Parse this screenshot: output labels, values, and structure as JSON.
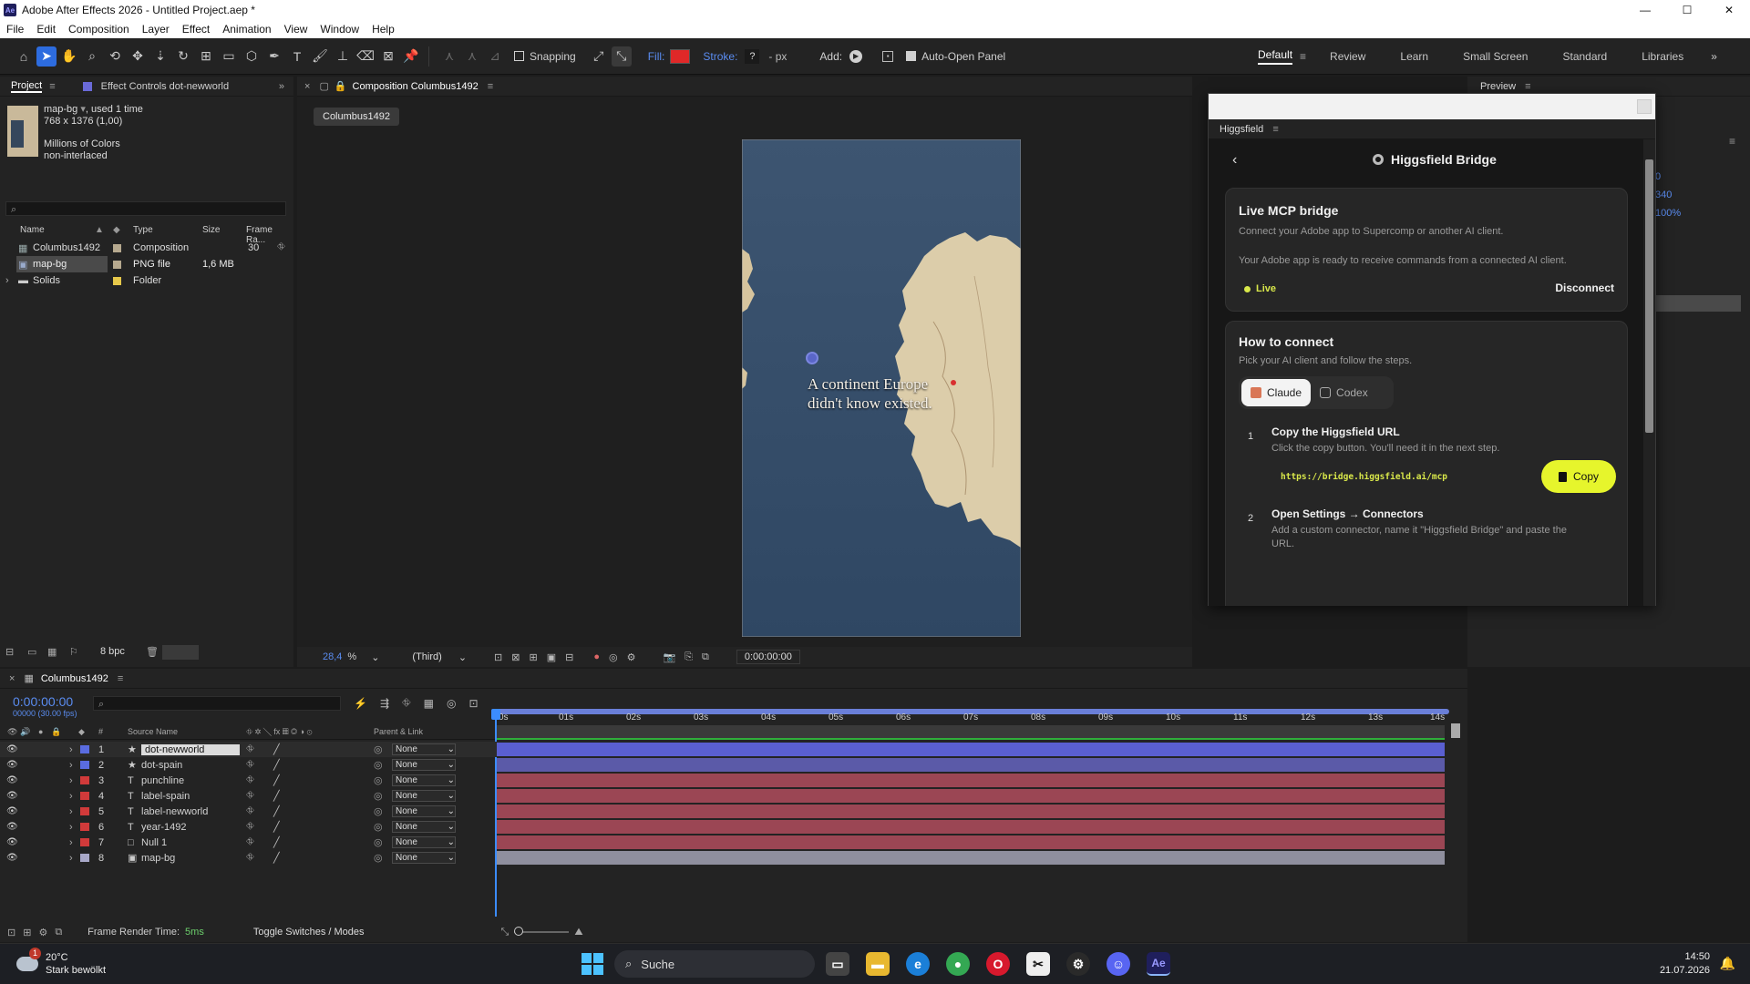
{
  "window": {
    "title": "Adobe After Effects 2026 - Untitled Project.aep *",
    "logo": "Ae",
    "buttons": [
      "—",
      "☐",
      "✕"
    ]
  },
  "menu": [
    "File",
    "Edit",
    "Composition",
    "Layer",
    "Effect",
    "Animation",
    "View",
    "Window",
    "Help"
  ],
  "toolbar": {
    "snapping_label": "Snapping",
    "fill_label": "Fill:",
    "fill_color": "#e02828",
    "stroke_label": "Stroke:",
    "stroke_value": "?",
    "stroke_unit": "- px",
    "add_label": "Add:",
    "auto_open_label": "Auto-Open Panel",
    "workspaces": [
      "Default",
      "Review",
      "Learn",
      "Small Screen",
      "Standard",
      "Libraries"
    ],
    "active_workspace": "Default"
  },
  "project": {
    "tab_label": "Project",
    "effect_tab_label": "Effect Controls dot-newworld",
    "asset_name": "map-bg",
    "asset_used": ", used 1 time",
    "asset_dims": "768 x 1376 (1,00)",
    "asset_colors": "Millions of Colors",
    "asset_interlace": "non-interlaced",
    "columns": [
      "Name",
      "Type",
      "Size",
      "Frame Ra..."
    ],
    "items": [
      {
        "name": "Columbus1492",
        "type": "Composition",
        "size": "",
        "fps": "30",
        "label_color": "#b6a98f"
      },
      {
        "name": "map-bg",
        "type": "PNG file",
        "size": "1,6 MB",
        "fps": "",
        "label_color": "#b6a98f"
      },
      {
        "name": "Solids",
        "type": "Folder",
        "size": "",
        "fps": "",
        "label_color": "#e6c84a"
      }
    ],
    "bpc": "8 bpc"
  },
  "composition": {
    "tab_label": "Composition Columbus1492",
    "breadcrumb": "Columbus1492",
    "zoom": "28,4",
    "zoom_unit": "%",
    "view": "(Third)",
    "timecode": "0:00:00:00",
    "overlay_line1": "A continent Europe",
    "overlay_line2": "didn't know existed."
  },
  "preview": {
    "tab_label": "Preview",
    "values": [
      "0",
      "340",
      "100%"
    ]
  },
  "higgsfield": {
    "panel_label": "Higgsfield",
    "title": "Higgsfield Bridge",
    "live_heading": "Live MCP bridge",
    "live_desc": "Connect your Adobe app to Supercomp or another AI client.",
    "live_ready": "Your Adobe app is ready to receive commands from a connected AI client.",
    "status": "Live",
    "disconnect_label": "Disconnect",
    "how_heading": "How to connect",
    "how_desc": "Pick your AI client and follow the steps.",
    "clients": [
      "Claude",
      "Codex"
    ],
    "step1_num": "1",
    "step1_title": "Copy the Higgsfield URL",
    "step1_desc": "Click the copy button. You'll need it in the next step.",
    "url": "https://bridge.higgsfield.ai/mcp",
    "copy_label": "Copy",
    "step2_num": "2",
    "step2_title": "Open Settings → Connectors",
    "step2_desc": "Add a custom connector, name it \"Higgsfield Bridge\" and paste the",
    "step2_desc_cont": "URL."
  },
  "timeline": {
    "tab_label": "Columbus1492",
    "timecode": "0:00:00:00",
    "timecode_sub": "00000 (30.00 fps)",
    "col_number": "#",
    "col_source": "Source Name",
    "col_parent": "Parent & Link",
    "ruler": [
      "0s",
      "01s",
      "02s",
      "03s",
      "04s",
      "05s",
      "06s",
      "07s",
      "08s",
      "09s",
      "10s",
      "11s",
      "12s",
      "13s",
      "14s"
    ],
    "layers": [
      {
        "num": "1",
        "name": "dot-newworld",
        "kind": "★",
        "label_color": "#5a6ce0",
        "parent": "None",
        "bar": "#5a5fd0"
      },
      {
        "num": "2",
        "name": "dot-spain",
        "kind": "★",
        "label_color": "#5a6ce0",
        "parent": "None",
        "bar": "#5b5aa8"
      },
      {
        "num": "3",
        "name": "punchline",
        "kind": "T",
        "label_color": "#d13a3a",
        "parent": "None",
        "bar": "#9b4654"
      },
      {
        "num": "4",
        "name": "label-spain",
        "kind": "T",
        "label_color": "#d13a3a",
        "parent": "None",
        "bar": "#9b4654"
      },
      {
        "num": "5",
        "name": "label-newworld",
        "kind": "T",
        "label_color": "#d13a3a",
        "parent": "None",
        "bar": "#9b4654"
      },
      {
        "num": "6",
        "name": "year-1492",
        "kind": "T",
        "label_color": "#d13a3a",
        "parent": "None",
        "bar": "#9b4654"
      },
      {
        "num": "7",
        "name": "Null 1",
        "kind": "□",
        "label_color": "#d13a3a",
        "parent": "None",
        "bar": "#9b4654"
      },
      {
        "num": "8",
        "name": "map-bg",
        "kind": "▣",
        "label_color": "#a8a8c8",
        "parent": "None",
        "bar": "#8f8f9e"
      }
    ],
    "render_label": "Frame Render Time:",
    "render_value": "5ms",
    "toggle_label": "Toggle Switches / Modes"
  },
  "taskbar": {
    "weather_temp": "20°C",
    "weather_desc": "Stark bewölkt",
    "weather_badge": "1",
    "search_placeholder": "Suche",
    "time": "14:50",
    "date": "21.07.2026"
  }
}
